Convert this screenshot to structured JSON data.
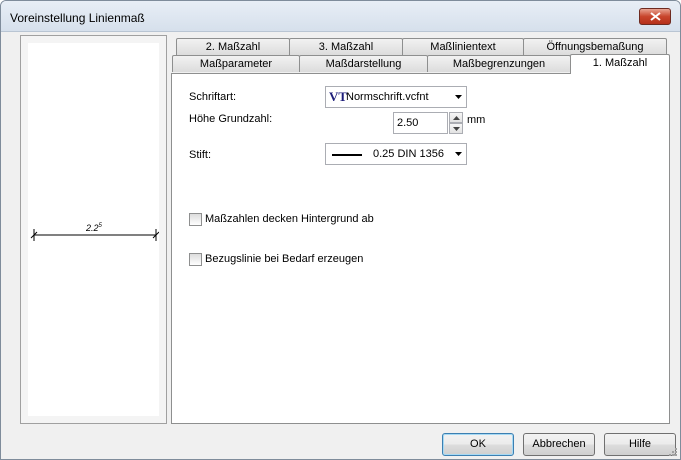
{
  "window": {
    "title": "Voreinstellung Linienmaß"
  },
  "preview": {
    "dimension_value": "2.2",
    "dimension_superscript": "5"
  },
  "tabs": {
    "row_back": [
      "2. Maßzahl",
      "3. Maßzahl",
      "Maßlinientext",
      "Öffnungsbemaßung"
    ],
    "row_front": [
      "Maßparameter",
      "Maßdarstellung",
      "Maßbegrenzungen",
      "1. Maßzahl"
    ],
    "active": "1. Maßzahl"
  },
  "form": {
    "font_label": "Schriftart:",
    "font_icon_text": "VT",
    "font_value": "Normschrift.vcfnt",
    "height_label": "Höhe Grundzahl:",
    "height_value": "2.50",
    "height_unit": "mm",
    "pen_label": "Stift:",
    "pen_value": "0.25 DIN 1356",
    "checkbox_background_label": "Maßzahlen decken Hintergrund ab",
    "checkbox_background_checked": false,
    "checkbox_reference_label": "Bezugslinie bei Bedarf erzeugen",
    "checkbox_reference_checked": false
  },
  "buttons": {
    "ok": "OK",
    "cancel": "Abbrechen",
    "help": "Hilfe"
  }
}
